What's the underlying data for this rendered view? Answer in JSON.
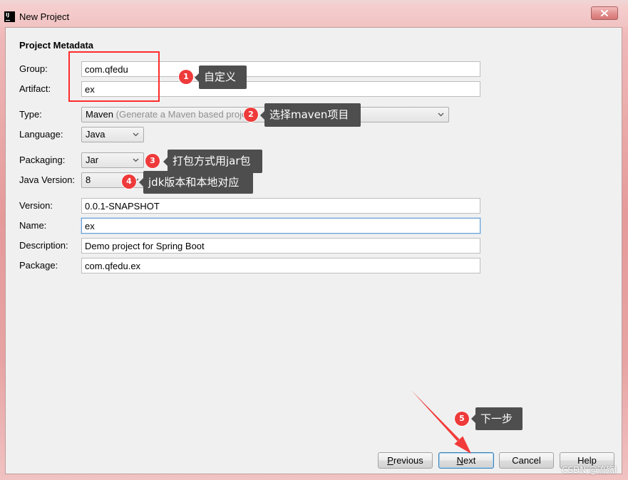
{
  "window": {
    "title": "New Project",
    "icon": "intellij-icon",
    "icon_lettering": "IJ",
    "close_icon": "close-icon"
  },
  "section_title": "Project Metadata",
  "form": {
    "group": {
      "label": "Group:",
      "value": "com.qfedu"
    },
    "artifact": {
      "label": "Artifact:",
      "value": "ex"
    },
    "type": {
      "label": "Type:",
      "value": "Maven",
      "hint": "(Generate a Maven based proje"
    },
    "language": {
      "label": "Language:",
      "value": "Java"
    },
    "packaging": {
      "label": "Packaging:",
      "value": "Jar"
    },
    "java_version": {
      "label": "Java Version:",
      "value": "8"
    },
    "version": {
      "label": "Version:",
      "value": "0.0.1-SNAPSHOT"
    },
    "name": {
      "label": "Name:",
      "value": "ex"
    },
    "description": {
      "label": "Description:",
      "value": "Demo project for Spring Boot"
    },
    "package": {
      "label": "Package:",
      "value": "com.qfedu.ex"
    }
  },
  "dropdown_icon": "chevron-down-icon",
  "buttons": {
    "previous": "Previous",
    "next": "Next",
    "cancel": "Cancel",
    "help": "Help"
  },
  "annotations": [
    {
      "number": "1",
      "text": "自定义"
    },
    {
      "number": "2",
      "text": "选择maven项目"
    },
    {
      "number": "3",
      "text": "打包方式用jar包"
    },
    {
      "number": "4",
      "text": "jdk版本和本地对应"
    },
    {
      "number": "5",
      "text": "下一步"
    }
  ],
  "watermark": "CSDN @流殇l",
  "colors": {
    "badge": "#ee3a3a",
    "callout": "#4e4e4e",
    "highlight": "#ff2b2b",
    "focus_border": "#6a9fd4",
    "frame": "#e59a9a"
  }
}
